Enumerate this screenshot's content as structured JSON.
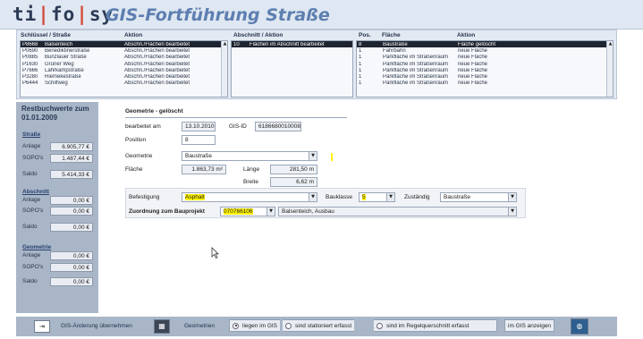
{
  "app": {
    "logo": [
      "ti",
      "fo",
      "sy"
    ],
    "title": "GIS-Fortführung Straße"
  },
  "list1": {
    "header_key": "Schlüssel / Straße",
    "header_action": "Aktion",
    "rows": [
      {
        "key": "P8668",
        "street": "Balsenteich",
        "action": "Abschn./Flächen bearbeitet",
        "selected": true
      },
      {
        "key": "P0690",
        "street": "Benediktinerstraße",
        "action": "Abschn./Flächen bearbeitet"
      },
      {
        "key": "P0885",
        "street": "Bunzlauer Straße",
        "action": "Abschn./Flächen bearbeitet"
      },
      {
        "key": "P1630",
        "street": "Grüner Weg",
        "action": "Abschn./Flächen bearbeitet"
      },
      {
        "key": "P7666",
        "street": "Lahrkampstraße",
        "action": "Abschn./Flächen bearbeitet"
      },
      {
        "key": "P3280",
        "street": "Riemekestraße",
        "action": "Abschn./Flächen bearbeitet"
      },
      {
        "key": "P6444",
        "street": "Schilfweg",
        "action": "Abschn./Flächen bearbeitet"
      }
    ]
  },
  "list2": {
    "header": "Abschnitt / Aktion",
    "rows": [
      {
        "nr": "10",
        "text": "Flächen im Abschnitt bearbeitet",
        "selected": true
      }
    ]
  },
  "list3": {
    "header_pos": "Pos.",
    "header_flaeche": "Fläche",
    "header_aktion": "Aktion",
    "rows": [
      {
        "pos": "8",
        "flaeche": "Baustraße",
        "aktion": "Fläche gelöscht",
        "selected": true
      },
      {
        "pos": "1",
        "flaeche": "Fahrbahn",
        "aktion": "neue Fläche"
      },
      {
        "pos": "1",
        "flaeche": "Parkfläche im Straßenraum",
        "aktion": "neue Fläche"
      },
      {
        "pos": "1",
        "flaeche": "Parkfläche im Straßenraum",
        "aktion": "neue Fläche"
      },
      {
        "pos": "1",
        "flaeche": "Parkfläche im Straßenraum",
        "aktion": "neue Fläche"
      },
      {
        "pos": "1",
        "flaeche": "Parkfläche im Straßenraum",
        "aktion": "neue Fläche"
      },
      {
        "pos": "1",
        "flaeche": "Parkfläche im Straßenraum",
        "aktion": "neue Fläche"
      }
    ]
  },
  "left": {
    "title1": "Restbuchwerte zum",
    "title2": "01.01.2009",
    "strasse": {
      "heading": "Straße",
      "anlage_label": "Anlage",
      "anlage": "6.905,77 €",
      "sopo_label": "SOPO's",
      "sopo": "1.487,44 €",
      "saldo_label": "Saldo",
      "saldo": "5.414,33 €"
    },
    "abschnitt": {
      "heading": "Abschnitt",
      "anlage_label": "Anlage",
      "anlage": "0,00 €",
      "sopo_label": "SOPO's",
      "sopo": "0,00 €",
      "saldo_label": "Saldo",
      "saldo": "0,00 €"
    },
    "geometrie": {
      "heading": "Geometrie",
      "anlage_label": "Anlage",
      "anlage": "0,00 €",
      "sopo_label": "SOPO's",
      "sopo": "0,00 €",
      "saldo_label": "Saldo",
      "saldo": "0,00 €"
    }
  },
  "form": {
    "section_title": "Geometrie - gelöscht",
    "bearbeitet_label": "bearbeitet am",
    "bearbeitet": "13.10.2010",
    "gisid_label": "GIS-ID",
    "gisid": "6186680010008",
    "position_label": "Position",
    "position": "8",
    "geometrie_label": "Geometrie",
    "geometrie": "Baustraße",
    "flaeche_label": "Fläche",
    "flaeche": "1.863,73 m²",
    "laenge_label": "Länge",
    "laenge": "281,50 m",
    "breite_label": "Breite",
    "breite": "6,62 m",
    "befestigung_label": "Befestigung",
    "befestigung": "Asphalt",
    "bauklasse_label": "Bauklasse",
    "bauklasse": "5",
    "zustaendig_label": "Zuständig",
    "zustaendig": "Baustraße",
    "bauprojekt_label": "Zuordnung zum Bauprojekt",
    "bauprojekt_nr": "070766106",
    "bauprojekt_name": "Balsenteich, Ausbau"
  },
  "footer": {
    "gis_uebernehmen": "GIS-Änderung übernehmen",
    "geometrien": "Geometrien",
    "opt1": "liegen im GIS",
    "opt2": "sind stationiert erfasst",
    "opt3": "sind im Regelquerschnitt erfasst",
    "gis_anzeigen": "im GIS anzeigen"
  },
  "colors": {
    "highlight": "#fff200",
    "selected_row": "#1e2430"
  }
}
